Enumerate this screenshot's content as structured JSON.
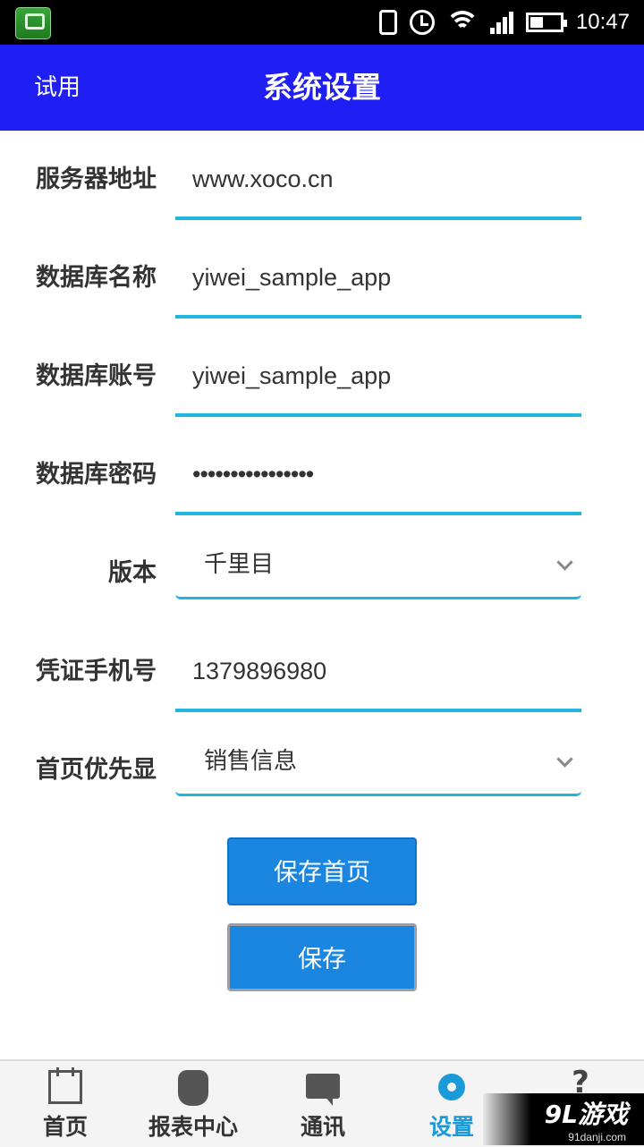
{
  "status_bar": {
    "time": "10:47",
    "icons": [
      "app-icon",
      "vibrate-icon",
      "alarm-icon",
      "wifi-icon",
      "signal-icon",
      "battery-icon"
    ]
  },
  "header": {
    "left_label": "试用",
    "title": "系统设置",
    "bg_color": "#1f1ff5"
  },
  "form": {
    "server": {
      "label": "服务器地址",
      "value": "www.xoco.cn"
    },
    "db_name": {
      "label": "数据库名称",
      "value": "yiwei_sample_app"
    },
    "db_account": {
      "label": "数据库账号",
      "value": "yiwei_sample_app"
    },
    "db_password": {
      "label": "数据库密码",
      "value": "••••••••••••••••"
    },
    "version": {
      "label": "版本",
      "value": "千里目"
    },
    "phone": {
      "label": "凭证手机号",
      "value": "1379896980"
    },
    "home_priority": {
      "label": "首页优先显",
      "value": "销售信息"
    }
  },
  "buttons": {
    "save_home": "保存首页",
    "save": "保存",
    "color": "#1a86e0"
  },
  "tabs": [
    {
      "label": "首页",
      "icon": "calendar-icon"
    },
    {
      "label": "报表中心",
      "icon": "hand-icon"
    },
    {
      "label": "通讯",
      "icon": "chat-icon"
    },
    {
      "label": "设置",
      "icon": "gear-icon",
      "active": true
    },
    {
      "label": "",
      "icon": "help-icon",
      "glyph": "?"
    }
  ],
  "watermark": {
    "brand": "9L游戏",
    "url": "91danji.com"
  }
}
